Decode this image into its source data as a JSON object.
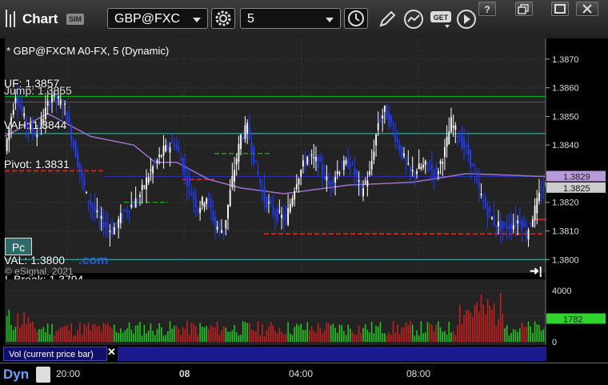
{
  "app": {
    "title": "Chart",
    "badge": "SIM"
  },
  "toolbar": {
    "symbol": "GBP@FXC",
    "interval": "5",
    "icons": [
      "gear-icon",
      "clock-icon",
      "pencil-icon",
      "study-icon",
      "get-icon",
      "play-icon"
    ],
    "window_buttons": [
      "help-icon",
      "restore-icon",
      "maximize-icon",
      "close-icon"
    ]
  },
  "chart": {
    "title": "* GBP@FXCM A0-FX, 5 (Dynamic)",
    "copyright": "© eSignal, 2021",
    "pc_label": "Pc",
    "com_text": ".com",
    "levels": {
      "uf": "UF: 1.3857",
      "jump": "Jump: 1.3855",
      "vah": "VAH: 1.3844",
      "pivot": "Pivot: 1.3831",
      "val": "VAL: 1.3800",
      "lbreak": "L Break: 1.3794"
    },
    "price_ticks": [
      "1.3870",
      "1.3860",
      "1.3850",
      "1.3840",
      "1.3830",
      "1.3820",
      "1.3810",
      "1.3800"
    ],
    "last_price": "1.3825",
    "lavender_price": "1.3829",
    "volume_ticks": [
      "4000",
      "2000",
      "0"
    ],
    "volume_last": "1782",
    "volume_label": "Vol (current price bar)",
    "time_ticks": [
      "20:00",
      "08",
      "04:00",
      "08:00"
    ],
    "dyn_label": "Dyn",
    "colors": {
      "up": "#ffffff",
      "down": "#1f3cff",
      "vol_up": "#1ec81e",
      "vol_down": "#c81e1e",
      "uf": "#00c020",
      "jump": "#e02020",
      "vah": "#40c0c0",
      "pivot": "#d02020",
      "val": "#40c0c0",
      "vwap": "#a070d0"
    }
  },
  "chart_data": {
    "type": "candlestick",
    "title": "* GBP@FXCM A0-FX, 5 (Dynamic)",
    "ylim": [
      1.3797,
      1.3875
    ],
    "x_labels": [
      "20:00",
      "08",
      "04:00",
      "08:00"
    ],
    "levels": {
      "UF": 1.3857,
      "Jump": 1.3855,
      "VAH": 1.3844,
      "Pivot": 1.3831,
      "VAL": 1.38,
      "L Break": 1.3794
    },
    "key_points": [
      {
        "i": 0,
        "p": 1.3838
      },
      {
        "i": 5,
        "p": 1.3858
      },
      {
        "i": 10,
        "p": 1.3847
      },
      {
        "i": 15,
        "p": 1.3844
      },
      {
        "i": 22,
        "p": 1.3858
      },
      {
        "i": 28,
        "p": 1.3853
      },
      {
        "i": 32,
        "p": 1.384
      },
      {
        "i": 38,
        "p": 1.3822
      },
      {
        "i": 44,
        "p": 1.3814
      },
      {
        "i": 50,
        "p": 1.381
      },
      {
        "i": 56,
        "p": 1.3817
      },
      {
        "i": 62,
        "p": 1.3821
      },
      {
        "i": 68,
        "p": 1.3831
      },
      {
        "i": 74,
        "p": 1.3838
      },
      {
        "i": 79,
        "p": 1.3841
      },
      {
        "i": 82,
        "p": 1.3835
      },
      {
        "i": 86,
        "p": 1.3825
      },
      {
        "i": 90,
        "p": 1.3818
      },
      {
        "i": 94,
        "p": 1.3822
      },
      {
        "i": 98,
        "p": 1.3812
      },
      {
        "i": 102,
        "p": 1.381
      },
      {
        "i": 106,
        "p": 1.3828
      },
      {
        "i": 110,
        "p": 1.3843
      },
      {
        "i": 113,
        "p": 1.3846
      },
      {
        "i": 117,
        "p": 1.3832
      },
      {
        "i": 121,
        "p": 1.3821
      },
      {
        "i": 126,
        "p": 1.3816
      },
      {
        "i": 131,
        "p": 1.3814
      },
      {
        "i": 136,
        "p": 1.3828
      },
      {
        "i": 141,
        "p": 1.3836
      },
      {
        "i": 146,
        "p": 1.3834
      },
      {
        "i": 151,
        "p": 1.3826
      },
      {
        "i": 156,
        "p": 1.3832
      },
      {
        "i": 161,
        "p": 1.3834
      },
      {
        "i": 166,
        "p": 1.3824
      },
      {
        "i": 170,
        "p": 1.383
      },
      {
        "i": 174,
        "p": 1.3848
      },
      {
        "i": 177,
        "p": 1.3852
      },
      {
        "i": 181,
        "p": 1.3845
      },
      {
        "i": 185,
        "p": 1.3837
      },
      {
        "i": 189,
        "p": 1.383
      },
      {
        "i": 193,
        "p": 1.3832
      },
      {
        "i": 197,
        "p": 1.3833
      },
      {
        "i": 201,
        "p": 1.383
      },
      {
        "i": 205,
        "p": 1.3838
      },
      {
        "i": 208,
        "p": 1.3848
      },
      {
        "i": 212,
        "p": 1.3842
      },
      {
        "i": 216,
        "p": 1.3837
      },
      {
        "i": 220,
        "p": 1.3826
      },
      {
        "i": 224,
        "p": 1.3818
      },
      {
        "i": 228,
        "p": 1.3813
      },
      {
        "i": 232,
        "p": 1.3811
      },
      {
        "i": 236,
        "p": 1.3812
      },
      {
        "i": 240,
        "p": 1.3814
      },
      {
        "i": 243,
        "p": 1.3809
      },
      {
        "i": 246,
        "p": 1.3815
      },
      {
        "i": 249,
        "p": 1.3822
      },
      {
        "i": 252,
        "p": 1.3826
      }
    ],
    "vwap_points": [
      {
        "i": 0,
        "p": 1.3843
      },
      {
        "i": 20,
        "p": 1.3851
      },
      {
        "i": 40,
        "p": 1.3843
      },
      {
        "i": 60,
        "p": 1.384
      },
      {
        "i": 70,
        "p": 1.3834
      },
      {
        "i": 80,
        "p": 1.3834
      },
      {
        "i": 95,
        "p": 1.3828
      },
      {
        "i": 110,
        "p": 1.3825
      },
      {
        "i": 130,
        "p": 1.3823
      },
      {
        "i": 160,
        "p": 1.3826
      },
      {
        "i": 190,
        "p": 1.3827
      },
      {
        "i": 215,
        "p": 1.383
      },
      {
        "i": 252,
        "p": 1.3829
      }
    ],
    "volume_ylim": [
      0,
      4500
    ]
  }
}
